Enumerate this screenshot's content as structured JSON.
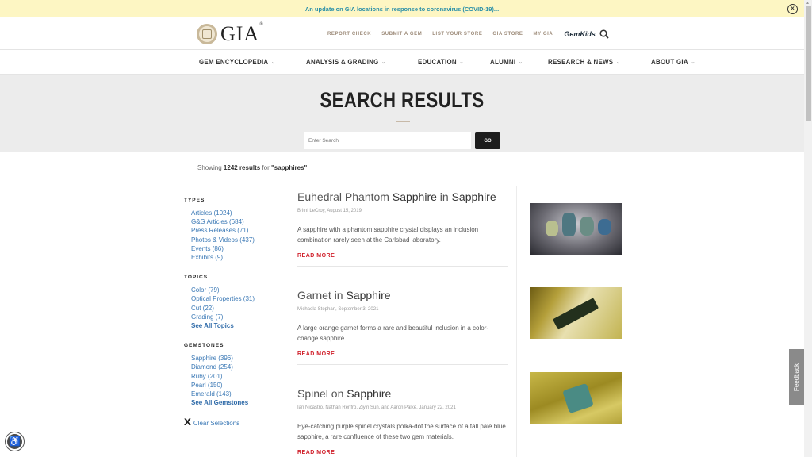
{
  "banner": {
    "text": "An update on GIA locations in response to coronavirus (COVID-19)...",
    "close_icon": "circle-x-icon"
  },
  "header": {
    "logo_text": "GIA",
    "logo_reg": "®",
    "utility_links": [
      "REPORT CHECK",
      "SUBMIT A GEM",
      "LIST YOUR STORE",
      "GIA STORE",
      "MY GIA"
    ],
    "gemkids_label": "GemKids",
    "search_icon": "magnifier-icon"
  },
  "main_nav": {
    "items": [
      {
        "label": "GEM ENCYCLOPEDIA"
      },
      {
        "label": "ANALYSIS & GRADING"
      },
      {
        "label": "EDUCATION"
      },
      {
        "label": "ALUMNI"
      },
      {
        "label": "RESEARCH & NEWS"
      },
      {
        "label": "ABOUT GIA"
      }
    ],
    "chevron": "⌄"
  },
  "hero": {
    "title": "SEARCH RESULTS",
    "search_placeholder": "Enter Search",
    "search_value": "",
    "go_label": "GO"
  },
  "summary": {
    "prefix": "Showing ",
    "count": "1242 results",
    "middle": " for ",
    "query": "\"sapphires\""
  },
  "sidebar": {
    "types": {
      "heading": "TYPES",
      "items": [
        "Articles (1024)",
        "G&G Articles (684)",
        "Press Releases (71)",
        "Photos & Videos (437)",
        "Events (86)",
        "Exhibits (9)"
      ]
    },
    "topics": {
      "heading": "TOPICS",
      "items": [
        "Color (79)",
        "Optical Properties (31)",
        "Cut (22)",
        "Grading (7)"
      ],
      "see_all": "See All Topics"
    },
    "gemstones": {
      "heading": "GEMSTONES",
      "items": [
        "Sapphire (396)",
        "Diamond (254)",
        "Ruby (201)",
        "Pearl (150)",
        "Emerald (143)"
      ],
      "see_all": "See All Gemstones"
    },
    "clear_x": "x",
    "clear_label": "Clear Selections"
  },
  "results": [
    {
      "title_plain": "Euhedral Phantom ",
      "title_hl1": "Sapphire",
      "title_mid": " in ",
      "title_hl2": "Sapphire",
      "meta": "Britni LeCroy, August 15, 2019",
      "description": "A sapphire with a phantom sapphire crystal displays an inclusion combination rarely seen at the Carlsbad laboratory.",
      "read_more": "READ MORE"
    },
    {
      "title_plain": "Garnet in ",
      "title_hl1": "Sapphire",
      "title_mid": "",
      "title_hl2": "",
      "meta": "Michaela Stephan, September 3, 2021",
      "description": "A large orange garnet forms a rare and beautiful inclusion in a color-change sapphire.",
      "read_more": "READ MORE"
    },
    {
      "title_plain": "Spinel on ",
      "title_hl1": "Sapphire",
      "title_mid": "",
      "title_hl2": "",
      "meta": "Ian Nicastro, Nathan Renfro, Ziyin Sun, and Aaron Palke, January 22, 2021",
      "description": "Eye-catching purple spinel crystals polka-dot the surface of a tall pale blue sapphire, a rare confluence of these two gem materials.",
      "read_more": "READ MORE"
    }
  ],
  "feedback_label": "Feedback",
  "accessibility_icon": "accessibility-person-icon"
}
